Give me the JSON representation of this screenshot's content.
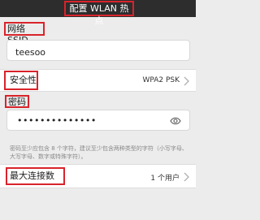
{
  "header": {
    "title": "配置 WLAN 热点"
  },
  "ssid": {
    "label": "网络 SSID",
    "value": "teesoo"
  },
  "security": {
    "label": "安全性",
    "value": "WPA2 PSK"
  },
  "password": {
    "label": "密码",
    "masked": "••••••••••••••",
    "hint": "密码至少应包含 8 个字符，建议至少包含两种类型的字符（小写字母、大写字母、数字或特殊字符）。"
  },
  "max_connections": {
    "label": "最大连接数",
    "value": "1 个用户"
  },
  "icons": {
    "eye": "eye-icon",
    "chevron": "chevron-right-icon"
  },
  "colors": {
    "highlight": "#d9232b",
    "titlebar": "#2d2d2d"
  }
}
